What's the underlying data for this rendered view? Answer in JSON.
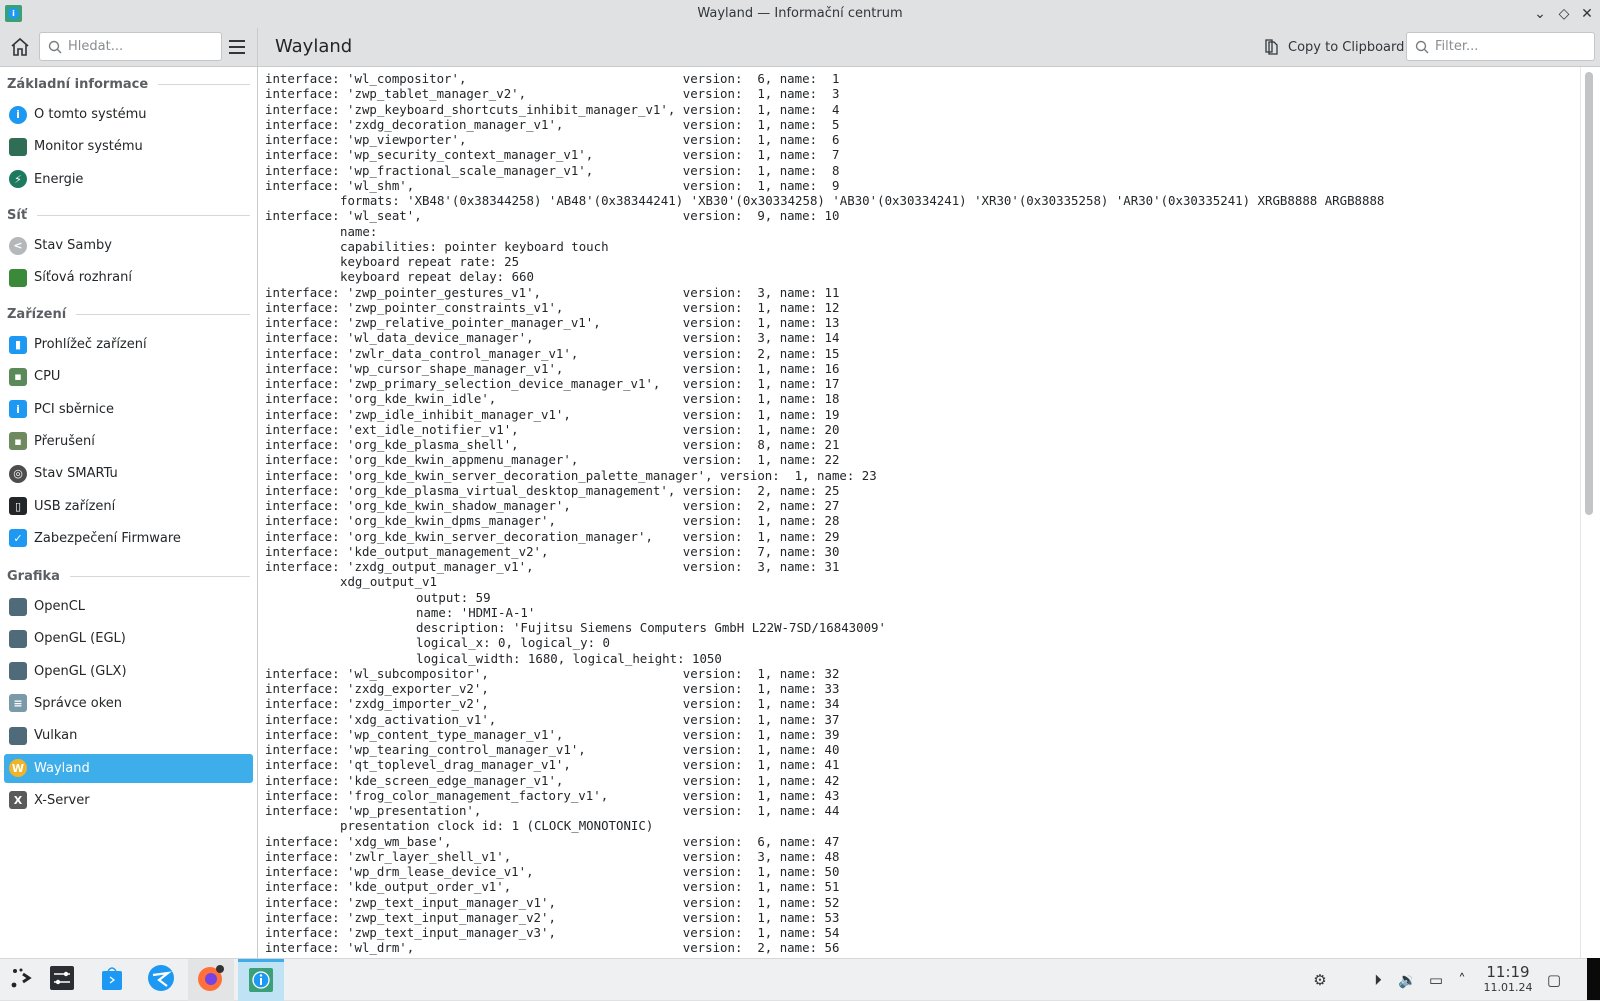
{
  "window": {
    "title": "Wayland — Informační centrum"
  },
  "toolbar": {
    "search_placeholder": "Hledat...",
    "page_title": "Wayland",
    "copy_label": "Copy to Clipboard",
    "filter_placeholder": "Filter..."
  },
  "sidebar": {
    "sections": [
      {
        "label": "Základní informace",
        "items": [
          {
            "label": "O tomto systému",
            "icon": "info-icon",
            "color": "#1d99f3",
            "glyph": "i"
          },
          {
            "label": "Monitor systému",
            "icon": "system-monitor-icon",
            "color": "#2f6e55",
            "glyph": ""
          },
          {
            "label": "Energie",
            "icon": "energy-icon",
            "color": "#1e7a5e",
            "glyph": "⚡"
          }
        ]
      },
      {
        "label": "Síť",
        "items": [
          {
            "label": "Stav Samby",
            "icon": "samba-icon",
            "color": "#b5b8bb",
            "glyph": "<"
          },
          {
            "label": "Síťová rozhraní",
            "icon": "network-card-icon",
            "color": "#3a8a3a",
            "glyph": ""
          }
        ]
      },
      {
        "label": "Zařízení",
        "items": [
          {
            "label": "Prohlížeč zařízení",
            "icon": "device-viewer-icon",
            "color": "#1d99f3",
            "glyph": "▮"
          },
          {
            "label": "CPU",
            "icon": "cpu-icon",
            "color": "#5a8a5a",
            "glyph": "▪"
          },
          {
            "label": "PCI sběrnice",
            "icon": "pci-icon",
            "color": "#1d99f3",
            "glyph": "i"
          },
          {
            "label": "Přerušení",
            "icon": "interrupts-icon",
            "color": "#6e8a5e",
            "glyph": "▪"
          },
          {
            "label": "Stav SMARTu",
            "icon": "smart-status-icon",
            "color": "#4d4d4d",
            "glyph": "◎"
          },
          {
            "label": "USB zařízení",
            "icon": "usb-icon",
            "color": "#232629",
            "glyph": "▯"
          },
          {
            "label": "Zabezpečení Firmware",
            "icon": "shield-icon",
            "color": "#1d99f3",
            "glyph": "✓"
          }
        ]
      },
      {
        "label": "Grafika",
        "items": [
          {
            "label": "OpenCL",
            "icon": "opencl-icon",
            "color": "#4f6b7a",
            "glyph": ""
          },
          {
            "label": "OpenGL (EGL)",
            "icon": "opengl-egl-icon",
            "color": "#4f6b7a",
            "glyph": ""
          },
          {
            "label": "OpenGL (GLX)",
            "icon": "opengl-glx-icon",
            "color": "#4f6b7a",
            "glyph": ""
          },
          {
            "label": "Správce oken",
            "icon": "window-manager-icon",
            "color": "#7a9aaa",
            "glyph": "≡"
          },
          {
            "label": "Vulkan",
            "icon": "vulkan-icon",
            "color": "#4f6b7a",
            "glyph": ""
          },
          {
            "label": "Wayland",
            "icon": "wayland-icon",
            "color": "#f0b429",
            "glyph": "W",
            "selected": true
          },
          {
            "label": "X-Server",
            "icon": "xserver-icon",
            "color": "#5a5a5a",
            "glyph": "X"
          }
        ]
      }
    ]
  },
  "labels": {
    "interface": "interface: ",
    "version": "version: ",
    "name": ", name: "
  },
  "lines": [
    {
      "i": "wl_compositor",
      "v": 6,
      "n": 1
    },
    {
      "i": "zwp_tablet_manager_v2",
      "v": 1,
      "n": 3
    },
    {
      "i": "zwp_keyboard_shortcuts_inhibit_manager_v1",
      "v": 1,
      "n": 4
    },
    {
      "i": "zxdg_decoration_manager_v1",
      "v": 1,
      "n": 5
    },
    {
      "i": "wp_viewporter",
      "v": 1,
      "n": 6
    },
    {
      "i": "wp_security_context_manager_v1",
      "v": 1,
      "n": 7
    },
    {
      "i": "wp_fractional_scale_manager_v1",
      "v": 1,
      "n": 8
    },
    {
      "i": "wl_shm",
      "v": 1,
      "n": 9
    },
    {
      "d": 1,
      "t": "formats: 'XB48'(0x38344258) 'AB48'(0x38344241) 'XB30'(0x30334258) 'AB30'(0x30334241) 'XR30'(0x30335258) 'AR30'(0x30335241) XRGB8888 ARGB8888"
    },
    {
      "i": "wl_seat",
      "v": 9,
      "n": 10
    },
    {
      "d": 1,
      "t": "name:"
    },
    {
      "d": 1,
      "t": "capabilities: pointer keyboard touch"
    },
    {
      "d": 1,
      "t": "keyboard repeat rate: 25"
    },
    {
      "d": 1,
      "t": "keyboard repeat delay: 660"
    },
    {
      "i": "zwp_pointer_gestures_v1",
      "v": 3,
      "n": 11
    },
    {
      "i": "zwp_pointer_constraints_v1",
      "v": 1,
      "n": 12
    },
    {
      "i": "zwp_relative_pointer_manager_v1",
      "v": 1,
      "n": 13
    },
    {
      "i": "wl_data_device_manager",
      "v": 3,
      "n": 14
    },
    {
      "i": "zwlr_data_control_manager_v1",
      "v": 2,
      "n": 15
    },
    {
      "i": "wp_cursor_shape_manager_v1",
      "v": 1,
      "n": 16
    },
    {
      "i": "zwp_primary_selection_device_manager_v1",
      "v": 1,
      "n": 17
    },
    {
      "i": "org_kde_kwin_idle",
      "v": 1,
      "n": 18
    },
    {
      "i": "zwp_idle_inhibit_manager_v1",
      "v": 1,
      "n": 19
    },
    {
      "i": "ext_idle_notifier_v1",
      "v": 1,
      "n": 20
    },
    {
      "i": "org_kde_plasma_shell",
      "v": 8,
      "n": 21
    },
    {
      "i": "org_kde_kwin_appmenu_manager",
      "v": 1,
      "n": 22
    },
    {
      "i": "org_kde_kwin_server_decoration_palette_manager",
      "v": 1,
      "n": 23
    },
    {
      "i": "org_kde_plasma_virtual_desktop_management",
      "v": 2,
      "n": 25
    },
    {
      "i": "org_kde_kwin_shadow_manager",
      "v": 2,
      "n": 27
    },
    {
      "i": "org_kde_kwin_dpms_manager",
      "v": 1,
      "n": 28
    },
    {
      "i": "org_kde_kwin_server_decoration_manager",
      "v": 1,
      "n": 29
    },
    {
      "i": "kde_output_management_v2",
      "v": 7,
      "n": 30
    },
    {
      "i": "zxdg_output_manager_v1",
      "v": 3,
      "n": 31
    },
    {
      "d": 1,
      "t": "xdg_output_v1"
    },
    {
      "d": 2,
      "t": "output: 59"
    },
    {
      "d": 2,
      "t": "name: 'HDMI-A-1'"
    },
    {
      "d": 2,
      "t": "description: 'Fujitsu Siemens Computers GmbH L22W-7SD/16843009'"
    },
    {
      "d": 2,
      "t": "logical_x: 0, logical_y: 0"
    },
    {
      "d": 2,
      "t": "logical_width: 1680, logical_height: 1050"
    },
    {
      "i": "wl_subcompositor",
      "v": 1,
      "n": 32
    },
    {
      "i": "zxdg_exporter_v2",
      "v": 1,
      "n": 33
    },
    {
      "i": "zxdg_importer_v2",
      "v": 1,
      "n": 34
    },
    {
      "i": "xdg_activation_v1",
      "v": 1,
      "n": 37
    },
    {
      "i": "wp_content_type_manager_v1",
      "v": 1,
      "n": 39
    },
    {
      "i": "wp_tearing_control_manager_v1",
      "v": 1,
      "n": 40
    },
    {
      "i": "qt_toplevel_drag_manager_v1",
      "v": 1,
      "n": 41
    },
    {
      "i": "kde_screen_edge_manager_v1",
      "v": 1,
      "n": 42
    },
    {
      "i": "frog_color_management_factory_v1",
      "v": 1,
      "n": 43
    },
    {
      "i": "wp_presentation",
      "v": 1,
      "n": 44
    },
    {
      "d": 1,
      "t": "presentation clock id: 1 (CLOCK_MONOTONIC)"
    },
    {
      "i": "xdg_wm_base",
      "v": 6,
      "n": 47
    },
    {
      "i": "zwlr_layer_shell_v1",
      "v": 3,
      "n": 48
    },
    {
      "i": "wp_drm_lease_device_v1",
      "v": 1,
      "n": 50
    },
    {
      "i": "kde_output_order_v1",
      "v": 1,
      "n": 51
    },
    {
      "i": "zwp_text_input_manager_v1",
      "v": 1,
      "n": 52
    },
    {
      "i": "zwp_text_input_manager_v2",
      "v": 1,
      "n": 53
    },
    {
      "i": "zwp_text_input_manager_v3",
      "v": 1,
      "n": 54
    },
    {
      "i": "wl_drm",
      "v": 2,
      "n": 56
    }
  ],
  "taskbar": {
    "apps": [
      {
        "name": "application-launcher",
        "icon": "launcher-icon"
      },
      {
        "name": "system-settings",
        "icon": "settings-icon"
      },
      {
        "name": "discover",
        "icon": "discover-store-icon"
      },
      {
        "name": "krdc",
        "icon": "remote-desktop-icon"
      },
      {
        "name": "firefox",
        "icon": "firefox-icon"
      },
      {
        "name": "info-center",
        "icon": "info-center-icon",
        "active": true
      }
    ],
    "clock_time": "11:19",
    "clock_date": "11.01.24"
  }
}
